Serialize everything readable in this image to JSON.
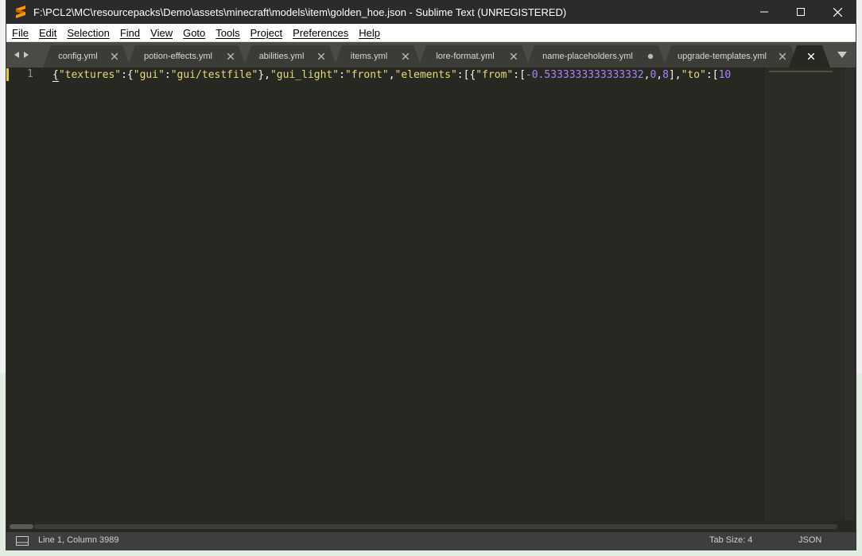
{
  "window": {
    "title": "F:\\PCL2\\MC\\resourcepacks\\Demo\\assets\\minecraft\\models\\item\\golden_hoe.json - Sublime Text (UNREGISTERED)",
    "app_icon": "sublime-text-icon",
    "controls": {
      "minimize_icon": "minimize-icon",
      "maximize_icon": "maximize-icon",
      "close_icon": "close-icon"
    }
  },
  "menu": {
    "items": [
      {
        "label": "File"
      },
      {
        "label": "Edit"
      },
      {
        "label": "Selection"
      },
      {
        "label": "Find"
      },
      {
        "label": "View"
      },
      {
        "label": "Goto"
      },
      {
        "label": "Tools"
      },
      {
        "label": "Project"
      },
      {
        "label": "Preferences"
      },
      {
        "label": "Help"
      }
    ]
  },
  "tabs": {
    "nav_left_icon": "arrow-left-icon",
    "nav_right_icon": "arrow-right-icon",
    "dropdown_icon": "triangle-down-icon",
    "items": [
      {
        "label": "config.yml",
        "state": "close"
      },
      {
        "label": "potion-effects.yml",
        "state": "close"
      },
      {
        "label": "abilities.yml",
        "state": "close"
      },
      {
        "label": "items.yml",
        "state": "close"
      },
      {
        "label": "lore-format.yml",
        "state": "close"
      },
      {
        "label": "name-placeholders.yml",
        "state": "modified"
      },
      {
        "label": "upgrade-templates.yml",
        "state": "close"
      },
      {
        "label": "",
        "state": "close",
        "active": true
      }
    ]
  },
  "editor": {
    "line_number": "1",
    "code_tokens": [
      {
        "t": "{",
        "c": "punct"
      },
      {
        "t": "\"textures\"",
        "c": "key"
      },
      {
        "t": ":{",
        "c": "punct"
      },
      {
        "t": "\"gui\"",
        "c": "key"
      },
      {
        "t": ":",
        "c": "punct"
      },
      {
        "t": "\"gui/testfile\"",
        "c": "str"
      },
      {
        "t": "},",
        "c": "punct"
      },
      {
        "t": "\"gui_light\"",
        "c": "key"
      },
      {
        "t": ":",
        "c": "punct"
      },
      {
        "t": "\"front\"",
        "c": "str"
      },
      {
        "t": ",",
        "c": "punct"
      },
      {
        "t": "\"elements\"",
        "c": "key"
      },
      {
        "t": ":[{",
        "c": "punct"
      },
      {
        "t": "\"from\"",
        "c": "key"
      },
      {
        "t": ":[",
        "c": "punct"
      },
      {
        "t": "-0.5333333333333332",
        "c": "num"
      },
      {
        "t": ",",
        "c": "punct"
      },
      {
        "t": "0",
        "c": "num"
      },
      {
        "t": ",",
        "c": "punct"
      },
      {
        "t": "8",
        "c": "num"
      },
      {
        "t": "],",
        "c": "punct"
      },
      {
        "t": "\"to\"",
        "c": "key"
      },
      {
        "t": ":[",
        "c": "punct"
      },
      {
        "t": "10",
        "c": "num"
      }
    ]
  },
  "status": {
    "panel_icon": "panel-toggle-icon",
    "position": "Line 1, Column 3989",
    "tab_size": "Tab Size: 4",
    "syntax": "JSON"
  },
  "colors": {
    "editor_bg": "#272822",
    "string": "#e6db74",
    "number": "#ae81ff",
    "line_marker": "#e6c84a"
  }
}
